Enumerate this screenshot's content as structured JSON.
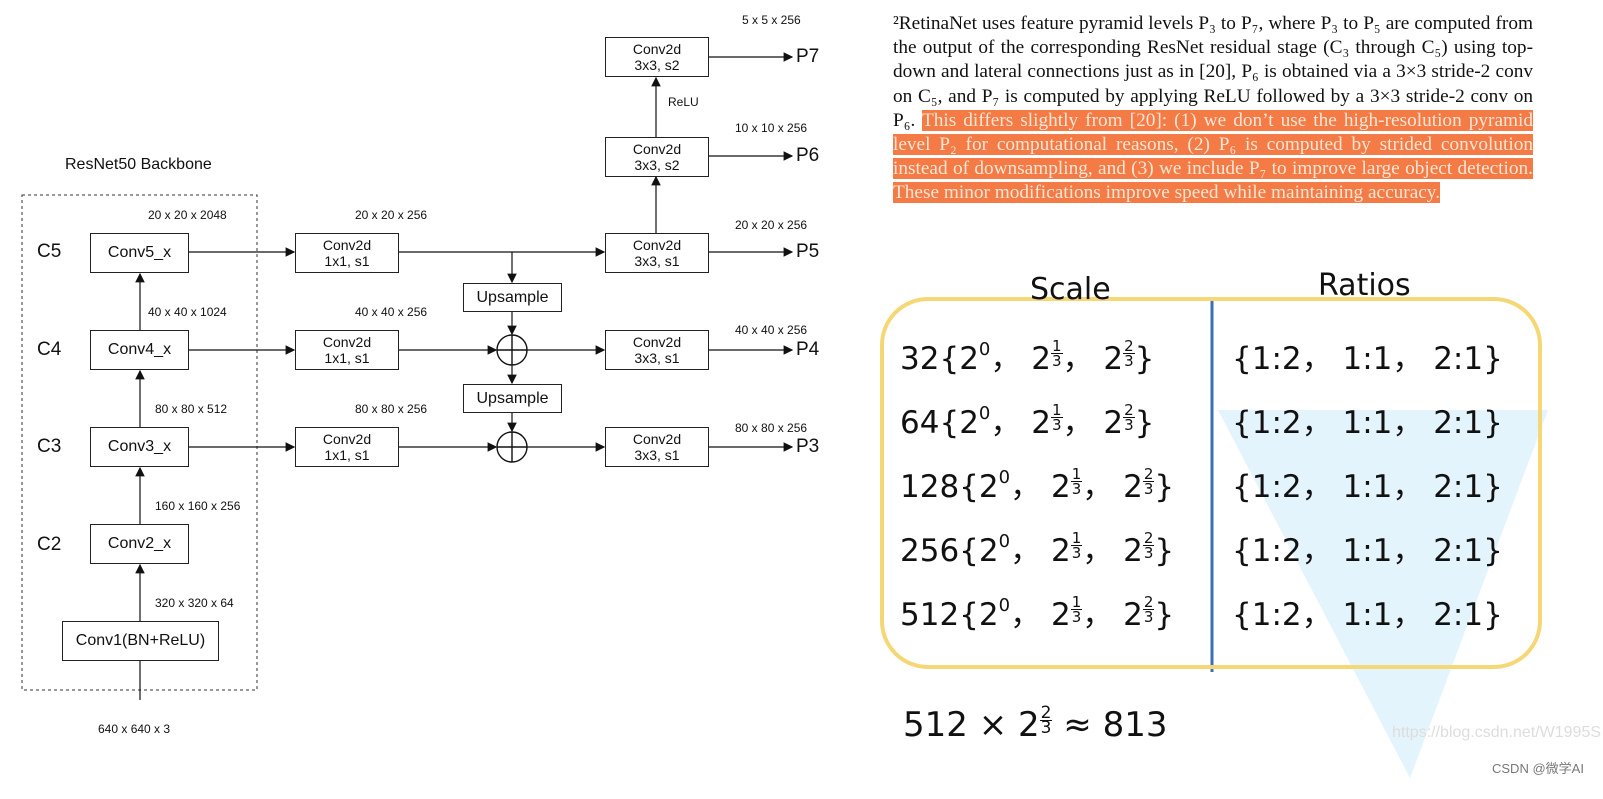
{
  "backbone": {
    "title": "ResNet50 Backbone",
    "stages": [
      {
        "level": "C5",
        "block": "Conv5_x",
        "out": "20 x 20 x 2048"
      },
      {
        "level": "C4",
        "block": "Conv4_x",
        "out": "40 x 40 x 1024"
      },
      {
        "level": "C3",
        "block": "Conv3_x",
        "out": "80 x 80 x 512"
      },
      {
        "level": "C2",
        "block": "Conv2_x",
        "out": "160 x 160 x 256"
      }
    ],
    "stem": {
      "block": "Conv1(BN+ReLU)",
      "out": "320 x 320 x 64"
    },
    "input": "640 x 640 x 3"
  },
  "lateral": [
    {
      "name": "Conv2d",
      "params": "1x1, s1",
      "out": "20 x 20 x 256"
    },
    {
      "name": "Conv2d",
      "params": "1x1, s1",
      "out": "40 x 40 x 256"
    },
    {
      "name": "Conv2d",
      "params": "1x1, s1",
      "out": "80 x 80 x 256"
    }
  ],
  "upsample_label": "Upsample",
  "outputs": [
    {
      "level": "P7",
      "name": "Conv2d",
      "params": "3x3, s2",
      "out": "5 x 5 x 256"
    },
    {
      "level": "P6",
      "name": "Conv2d",
      "params": "3x3, s2",
      "out": "10 x 10 x 256"
    },
    {
      "level": "P5",
      "name": "Conv2d",
      "params": "3x3, s1",
      "out": "20 x 20 x 256"
    },
    {
      "level": "P4",
      "name": "Conv2d",
      "params": "3x3, s1",
      "out": "40 x 40 x 256"
    },
    {
      "level": "P3",
      "name": "Conv2d",
      "params": "3x3, s1",
      "out": "80 x 80 x 256"
    }
  ],
  "relu_label": "ReLU",
  "paper_text": {
    "normal": "²RetinaNet uses feature pyramid levels P₃ to P₇, where P₃ to P₅ are computed from the output of the corresponding ResNet residual stage (C₃ through C₅) using top-down and lateral connections just as in [20], P₆ is obtained via a 3×3 stride-2 conv on C₅, and P₇ is computed by applying ReLU followed by a 3×3 stride-2 conv on P₆.",
    "highlighted": "This differs slightly from [20]: (1) we don’t use the high-resolution pyramid level P₂ for computational reasons, (2) P₆ is computed by strided convolution instead of downsampling, and (3) we include P₇ to improve large object detection. These minor modifications improve speed while maintaining accuracy.",
    "highlight_color": "#f47b45",
    "ref_color": "#2a8a2a"
  },
  "anchor_table": {
    "headers": [
      "Scale",
      "Ratios"
    ],
    "scales": [
      "32",
      "64",
      "128",
      "256",
      "512"
    ],
    "exponents": [
      "2",
      "0",
      "1",
      "3",
      "2",
      "3"
    ],
    "ratios": "{1:2，  1:1，  2:1}",
    "border_color": "#f6d776",
    "divider_color": "#3b6fb6"
  },
  "formula": {
    "base": "512 × 2",
    "num": "2",
    "den": "3",
    "result": "≈ 813"
  },
  "watermarks": [
    "https://blog.csdn.net/W1995S",
    "CSDN @微学AI"
  ]
}
